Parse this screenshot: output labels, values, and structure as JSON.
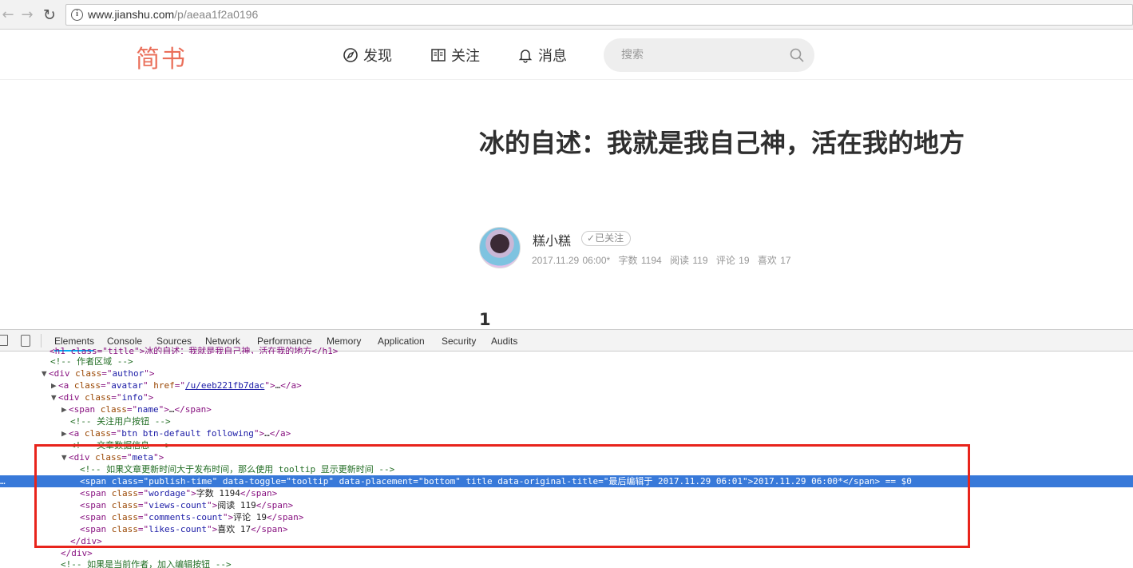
{
  "browser": {
    "url_host": "www.jianshu.com",
    "url_path": "/p/aeaa1f2a0196"
  },
  "header": {
    "logo": "简书",
    "nav": [
      {
        "label": "发现"
      },
      {
        "label": "关注"
      },
      {
        "label": "消息"
      }
    ],
    "search_placeholder": "搜索"
  },
  "article": {
    "title": "冰的自述：我就是我自己神，活在我的地方",
    "author": "糕小糕",
    "follow_label": "已关注",
    "meta": {
      "publish_time": "2017.11.29 06:00*",
      "wordage": "字数 1194",
      "views": "阅读 119",
      "comments": "评论 19",
      "likes": "喜欢 17"
    },
    "section_number": "1"
  },
  "devtools": {
    "tabs": [
      "Elements",
      "Console",
      "Sources",
      "Network",
      "Performance",
      "Memory",
      "Application",
      "Security",
      "Audits"
    ],
    "active_tab": "Elements",
    "lines": {
      "l0": "<h1 class=\"title\">冰的自述：我就是我自己神，活在我的地方</h1>",
      "l1": "<!-- 作者区域 -->",
      "l2_tag": "div",
      "l2_attr": "class",
      "l2_val": "author",
      "l3_tag": "a",
      "l3_attr1": "class",
      "l3_val1": "avatar",
      "l3_attr2": "href",
      "l3_val2": "/u/eeb221fb7dac",
      "l4_tag": "div",
      "l4_attr": "class",
      "l4_val": "info",
      "l5_tag": "span",
      "l5_attr": "class",
      "l5_val": "name",
      "l6": "<!-- 关注用户按钮 -->",
      "l7_tag": "a",
      "l7_attr": "class",
      "l7_val": "btn btn-default following",
      "l8": "<!-- 文章数据信息 -->",
      "l9_tag": "div",
      "l9_attr": "class",
      "l9_val": "meta",
      "l10": "<!-- 如果文章更新时间大于发布时间，那么使用 tooltip 显示更新时间 -->",
      "l11_val1": "publish-time",
      "l11_val2": "tooltip",
      "l11_val3": "bottom",
      "l11_val4": "最后编辑于 2017.11.29 06:01",
      "l11_text": "2017.11.29 06:00*",
      "l11_suffix": " == $0",
      "l12_val": "wordage",
      "l12_text": "字数 1194",
      "l13_val": "views-count",
      "l13_text": "阅读 119",
      "l14_val": "comments-count",
      "l14_text": "评论 19",
      "l15_val": "likes-count",
      "l15_text": "喜欢 17",
      "l18": "<!-- 如果是当前作者，加入编辑按钮 -->"
    }
  }
}
